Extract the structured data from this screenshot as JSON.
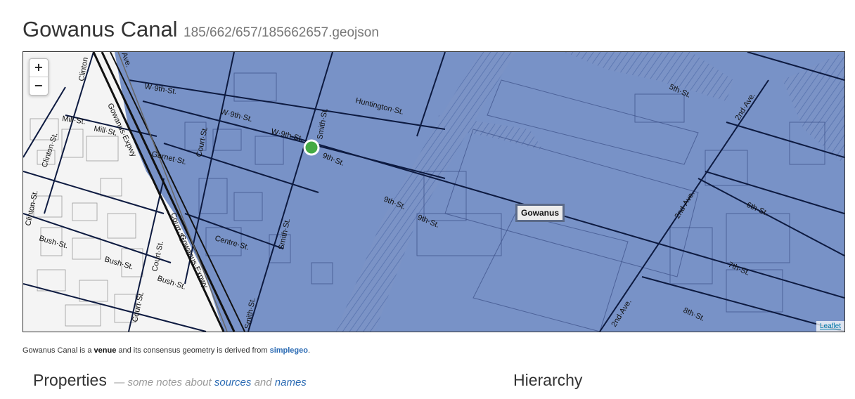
{
  "header": {
    "title": "Gowanus Canal",
    "path": "185/662/657/185662657.geojson"
  },
  "map": {
    "zoom_in": "+",
    "zoom_out": "−",
    "attribution": "Leaflet",
    "place_label": "Gowanus",
    "polygon_color": "#6d89c2",
    "marker_color": "#44aa44",
    "streets": [
      "W·9th·St.",
      "W·9th·St.",
      "W·9th·St.",
      "9th·St.",
      "9th·St.",
      "9th·St.",
      "Huntington·St.",
      "Smith·St.",
      "Smith·St.",
      "Court·St.",
      "Court·St.",
      "Court·St.",
      "Garnet·St.",
      "Centre·St.",
      "Mill·St.",
      "Mill·St.",
      "Bush·St.",
      "Bush·St.",
      "Bush·St.",
      "Clinton·St.",
      "Clinton·St.",
      "Gowanus·Expwy",
      "5th·St.",
      "6th·St.",
      "7th·St.",
      "8th·St.",
      "2nd·Ave.",
      "2nd·Ave.",
      "2nd·Ave.",
      "Clinton",
      "Court·St.",
      "Gowanus·Expwy",
      "Ave.",
      "Smith·St."
    ]
  },
  "description": {
    "name": "Gowanus Canal",
    "text1": " is a ",
    "placetype": "venue",
    "text2": " and its consensus geometry is derived from ",
    "source": "simplegeo",
    "text3": "."
  },
  "properties": {
    "heading": "Properties",
    "note_prefix": "— some notes about ",
    "link_sources": "sources",
    "note_and": " and ",
    "link_names": "names"
  },
  "hierarchy": {
    "heading": "Hierarchy"
  }
}
